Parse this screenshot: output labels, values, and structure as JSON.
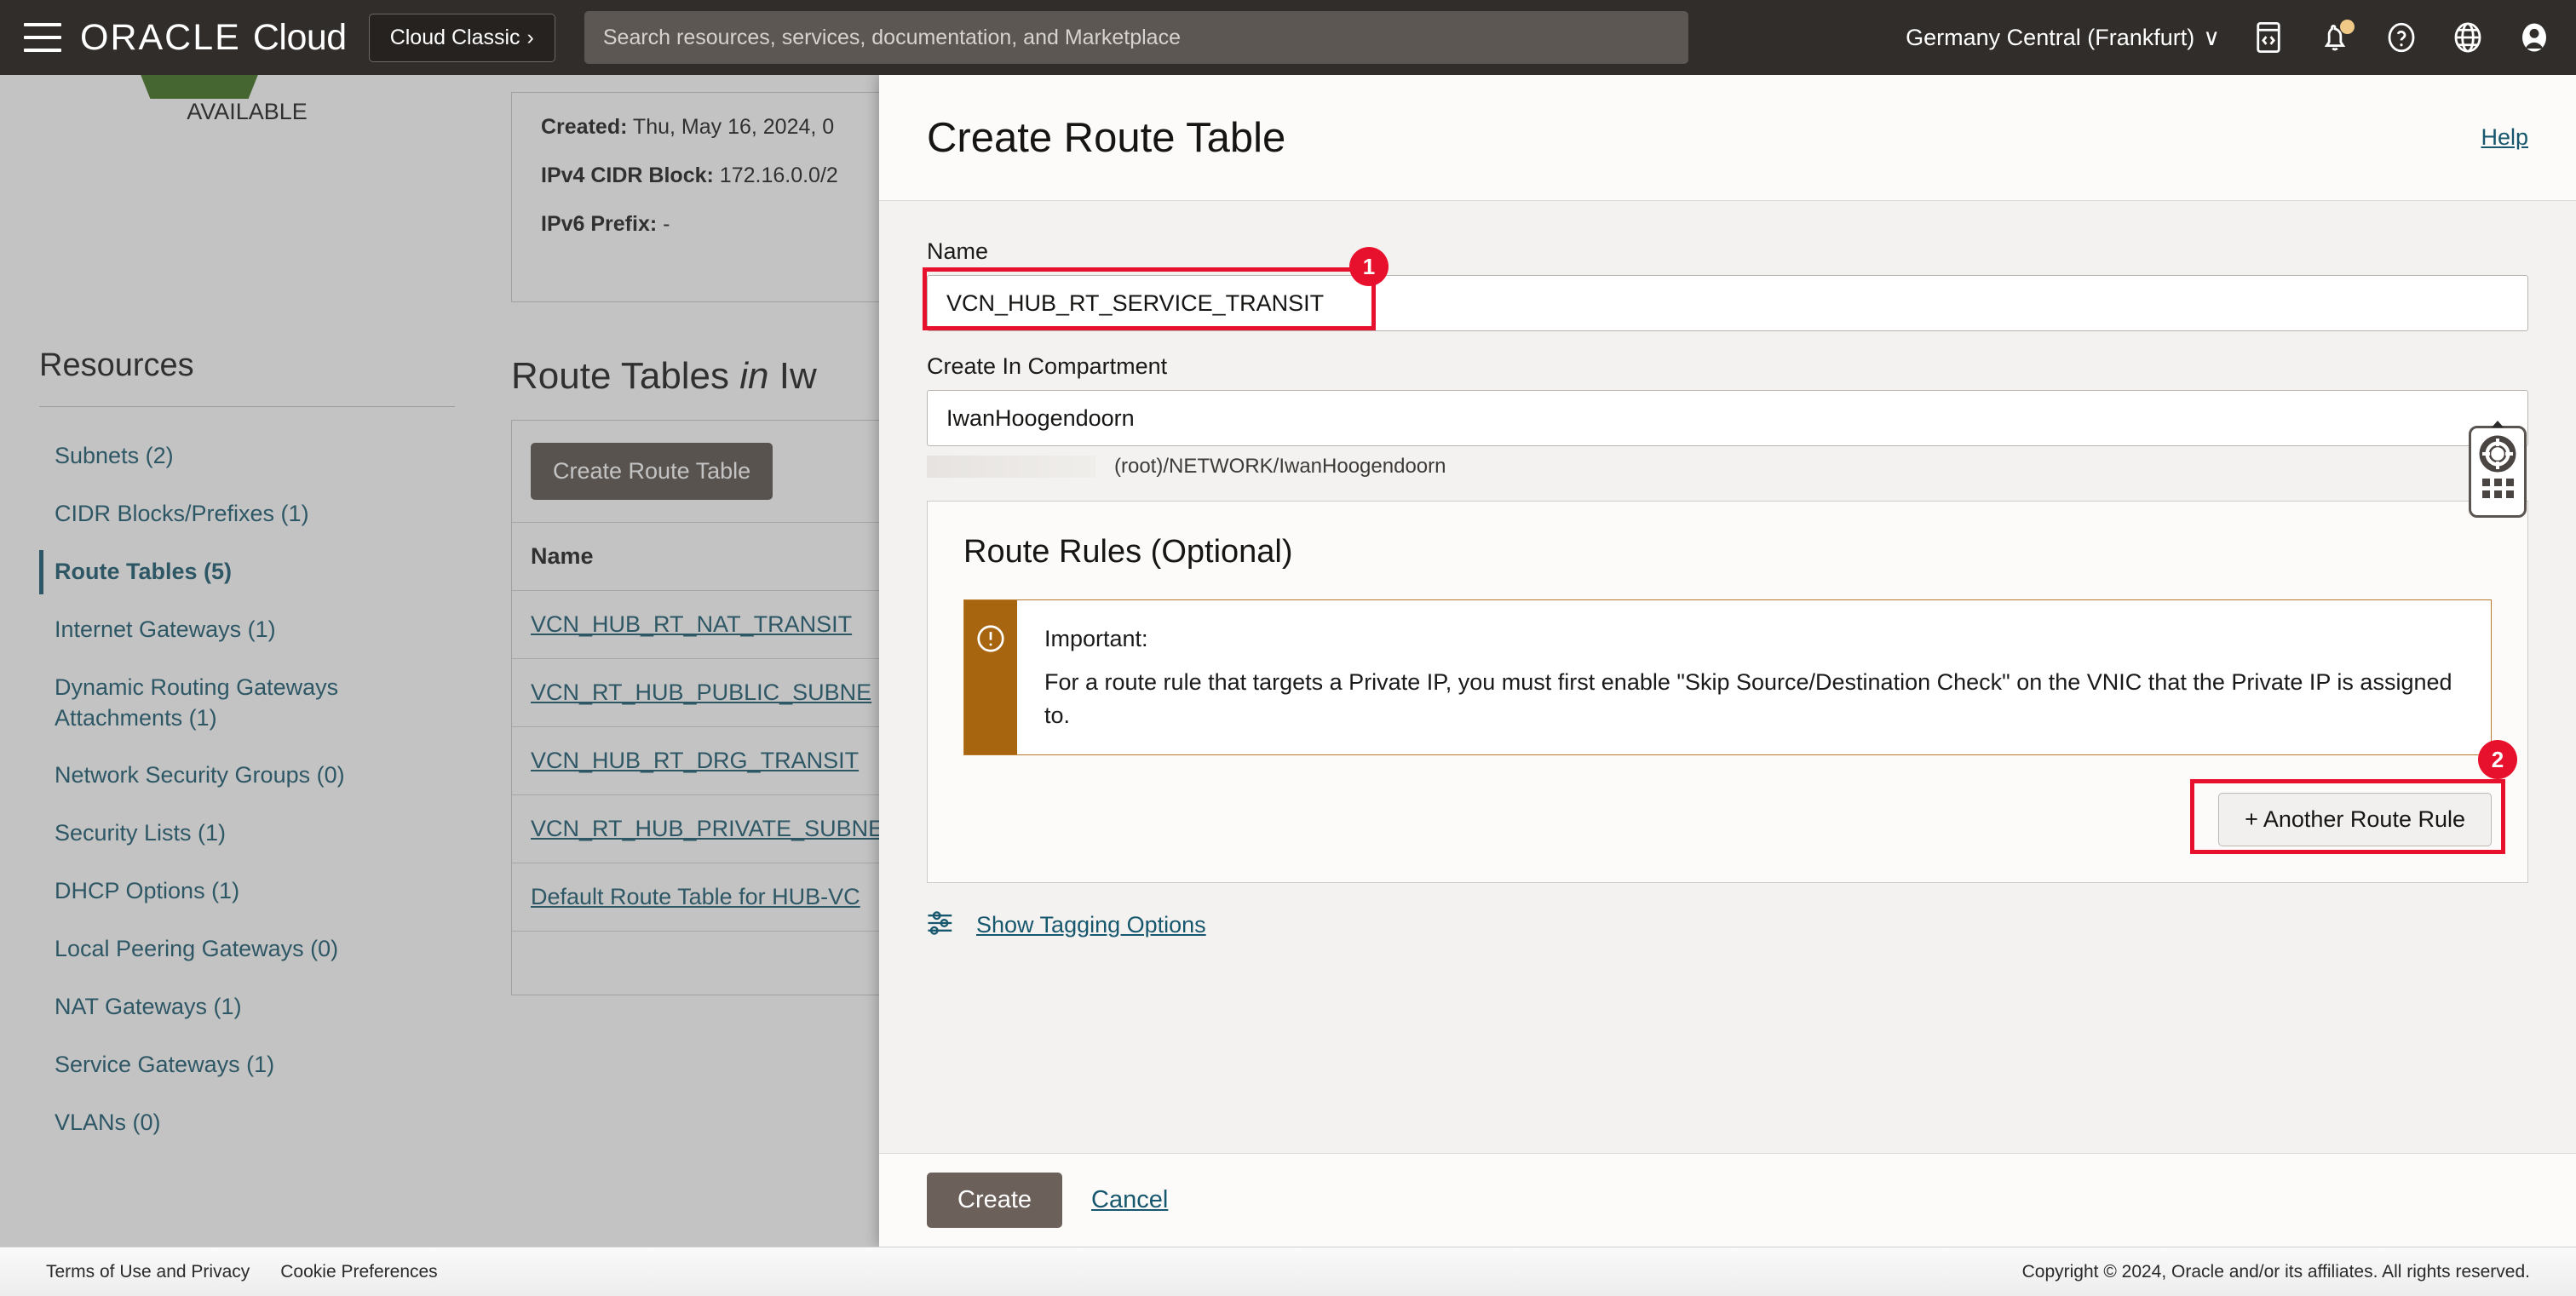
{
  "header": {
    "menu_icon": "hamburger-icon",
    "brand_oracle": "ORACLE",
    "brand_cloud": "Cloud",
    "classic_button": "Cloud Classic",
    "classic_chevron": "›",
    "search_placeholder": "Search resources, services, documentation, and Marketplace",
    "region": "Germany Central (Frankfurt)",
    "region_chevron": "∨",
    "icons": [
      "cloud-shell-icon",
      "notifications-bell-icon",
      "help-question-icon",
      "language-globe-icon",
      "user-avatar-icon"
    ]
  },
  "sidebar": {
    "status": "AVAILABLE",
    "title": "Resources",
    "items": [
      {
        "label": "Subnets (2)",
        "active": false
      },
      {
        "label": "CIDR Blocks/Prefixes (1)",
        "active": false
      },
      {
        "label": "Route Tables (5)",
        "active": true
      },
      {
        "label": "Internet Gateways (1)",
        "active": false
      },
      {
        "label": "Dynamic Routing Gateways Attachments (1)",
        "active": false
      },
      {
        "label": "Network Security Groups (0)",
        "active": false
      },
      {
        "label": "Security Lists (1)",
        "active": false
      },
      {
        "label": "DHCP Options (1)",
        "active": false
      },
      {
        "label": "Local Peering Gateways (0)",
        "active": false
      },
      {
        "label": "NAT Gateways (1)",
        "active": false
      },
      {
        "label": "Service Gateways (1)",
        "active": false
      },
      {
        "label": "VLANs (0)",
        "active": false
      }
    ]
  },
  "vcn_details": {
    "created_label": "Created:",
    "created_value": "Thu, May 16, 2024, 0",
    "cidr_label": "IPv4 CIDR Block:",
    "cidr_value": "172.16.0.0/2",
    "ipv6_label": "IPv6 Prefix:",
    "ipv6_value": "-"
  },
  "route_tables": {
    "heading_prefix": "Route Tables",
    "heading_in": "in",
    "heading_scope": "Iw",
    "create_button": "Create Route Table",
    "column_name": "Name",
    "rows": [
      "VCN_HUB_RT_NAT_TRANSIT",
      "VCN_RT_HUB_PUBLIC_SUBNE",
      "VCN_HUB_RT_DRG_TRANSIT",
      "VCN_RT_HUB_PRIVATE_SUBNE",
      "Default Route Table for HUB-VC"
    ]
  },
  "modal": {
    "title": "Create Route Table",
    "help_link": "Help",
    "name_label": "Name",
    "name_value": "VCN_HUB_RT_SERVICE_TRANSIT",
    "compartment_label": "Create In Compartment",
    "compartment_value": "IwanHoogendoorn",
    "compartment_path": "(root)/NETWORK/IwanHoogendoorn",
    "rules_title": "Route Rules (Optional)",
    "callout": {
      "icon": "warning-exclamation-icon",
      "title": "Important:",
      "text": "For a route rule that targets a Private IP, you must first enable \"Skip Source/Destination Check\" on the VNIC that the Private IP is assigned to."
    },
    "another_rule_button": "+ Another Route Rule",
    "tagging_icon": "tag-sliders-icon",
    "tagging_link": "Show Tagging Options",
    "create_button": "Create",
    "cancel_link": "Cancel"
  },
  "annotations": {
    "badge_1": "1",
    "badge_2": "2",
    "color": "#e8112d"
  },
  "help_widget": {
    "icon": "life-ring-help-icon",
    "handle": "drag-dot-grid"
  },
  "footer": {
    "terms": "Terms of Use and Privacy",
    "cookies": "Cookie Preferences",
    "copyright": "Copyright © 2024, Oracle and/or its affiliates. All rights reserved."
  }
}
